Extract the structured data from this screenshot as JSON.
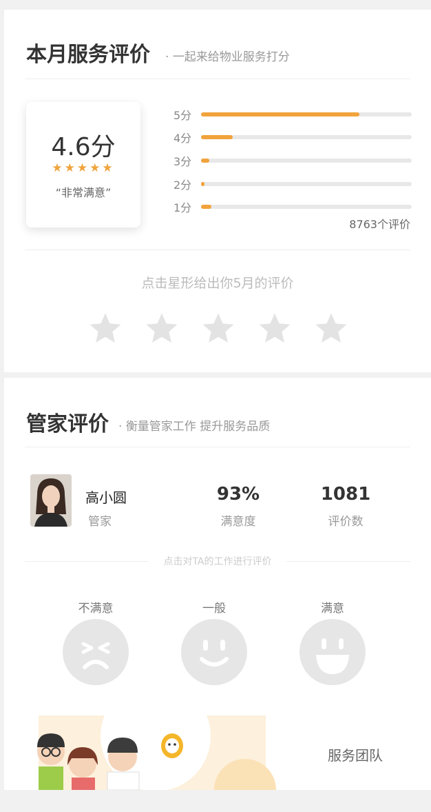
{
  "monthly": {
    "title": "本月服务评价",
    "subtitle": "· 一起来给物业服务打分",
    "score": "4.6分",
    "stars": "★★★★★",
    "verdict": "“非常满意”",
    "bars": [
      {
        "label": "5分",
        "value": 0.75
      },
      {
        "label": "4分",
        "value": 0.15
      },
      {
        "label": "3分",
        "value": 0.04
      },
      {
        "label": "2分",
        "value": 0.015
      },
      {
        "label": "1分",
        "value": 0.05
      }
    ],
    "count": "8763个评价",
    "hint": "点击星形给出你5月的评价"
  },
  "butler": {
    "title": "管家评价",
    "subtitle": "· 衡量管家工作 提升服务品质",
    "name": "高小圆",
    "role": "管家",
    "satisfaction_value": "93%",
    "satisfaction_label": "满意度",
    "reviews_value": "1081",
    "reviews_label": "评价数",
    "hint": "点击对TA的工作进行评价",
    "faces": [
      {
        "label": "不满意",
        "icon": "unhappy-face-icon"
      },
      {
        "label": "一般",
        "icon": "neutral-face-icon"
      },
      {
        "label": "满意",
        "icon": "happy-face-icon"
      }
    ]
  },
  "team": {
    "label": "服务团队"
  },
  "colors": {
    "accent": "#f1a33c",
    "inactive": "#e6e6e6"
  }
}
